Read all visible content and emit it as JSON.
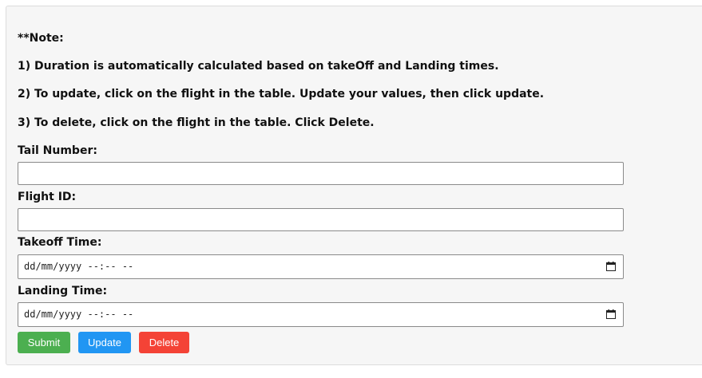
{
  "notes": {
    "heading": "**Note:",
    "line1": "1) Duration is automatically calculated based on takeOff and Landing times.",
    "line2": "2) To update, click on the flight in the table. Update your values, then click update.",
    "line3": "3) To delete, click on the flight in the table. Click Delete."
  },
  "form": {
    "tail_number": {
      "label": "Tail Number:",
      "value": ""
    },
    "flight_id": {
      "label": "Flight ID:",
      "value": ""
    },
    "takeoff_time": {
      "label": "Takeoff Time:",
      "placeholder": "dd/mm/yyyy --:-- --"
    },
    "landing_time": {
      "label": "Landing Time:",
      "placeholder": "dd/mm/yyyy --:-- --"
    }
  },
  "buttons": {
    "submit": "Submit",
    "update": "Update",
    "delete": "Delete"
  },
  "colors": {
    "submit": "#4caf50",
    "update": "#2196f3",
    "delete": "#f44336",
    "panel_bg": "#f6f6f6"
  },
  "icons": {
    "takeoff_picker": "calendar-icon",
    "landing_picker": "calendar-icon"
  }
}
